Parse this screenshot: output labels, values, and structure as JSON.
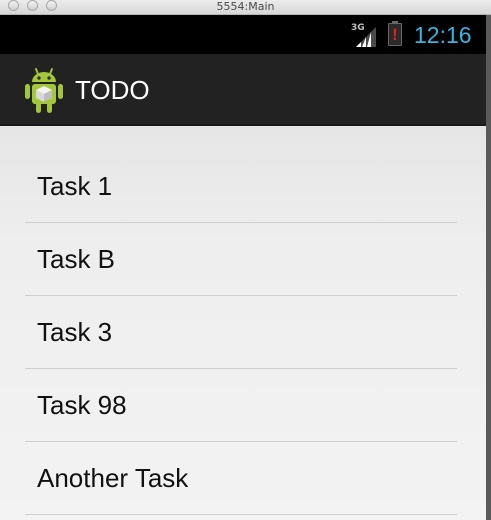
{
  "window": {
    "title": "5554:Main"
  },
  "status_bar": {
    "network_label": "3G",
    "time": "12:16",
    "signal_icon": "signal-bars-icon",
    "battery_icon": "battery-alert-icon",
    "battery_alert_text": "!",
    "accent_color": "#33b5e5"
  },
  "action_bar": {
    "app_icon": "android-robot-icon",
    "title": "TODO"
  },
  "tasks": [
    {
      "label": "Task 1"
    },
    {
      "label": "Task B"
    },
    {
      "label": "Task 3"
    },
    {
      "label": "Task 98"
    },
    {
      "label": "Another Task"
    }
  ]
}
